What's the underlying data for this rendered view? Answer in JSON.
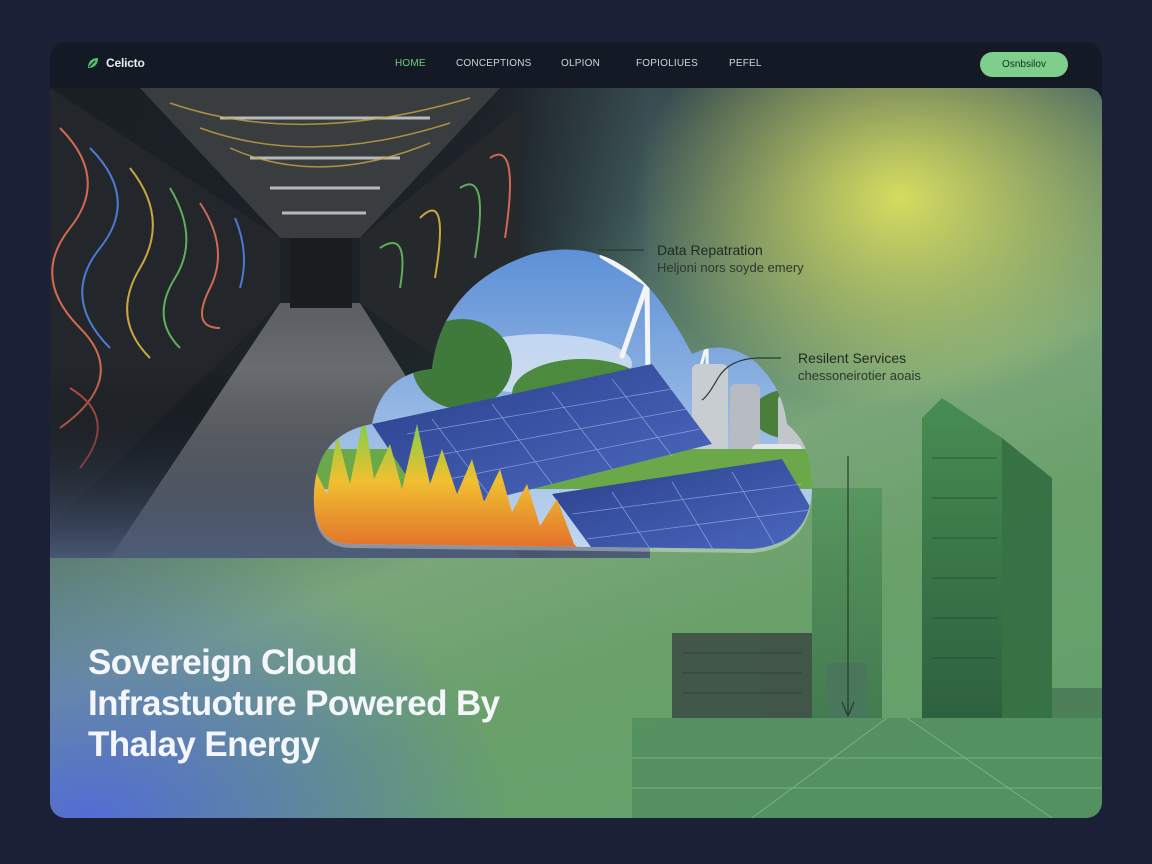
{
  "brand": {
    "name": "Celicto"
  },
  "nav": {
    "links": [
      {
        "label": "HOME",
        "active": true
      },
      {
        "label": "CONCEPTIONS"
      },
      {
        "label": "OLPION"
      },
      {
        "label": "FOPIOLIUES"
      },
      {
        "label": "PEFEL"
      }
    ],
    "cta_label": "Osnbsilov"
  },
  "callouts": [
    {
      "title": "Data Repatration",
      "subtitle": "Heljoni nors soyde emery"
    },
    {
      "title": "Resilent Services",
      "subtitle": "chessoneirotier aoais"
    }
  ],
  "hero": {
    "headline_lines": [
      "Sovereign Cloud",
      "Infrastuoture Powered By",
      "Thalay Energy"
    ]
  },
  "colors": {
    "page_bg": "#1b2036",
    "accent_green": "#6fcf7a",
    "cta_bg": "#7fcf8c",
    "hero_yellow": "#dde260",
    "hero_blue": "#526cd6"
  },
  "icons": {
    "logo": "leaf-logo-icon",
    "arrow": "arrow-down-icon"
  }
}
